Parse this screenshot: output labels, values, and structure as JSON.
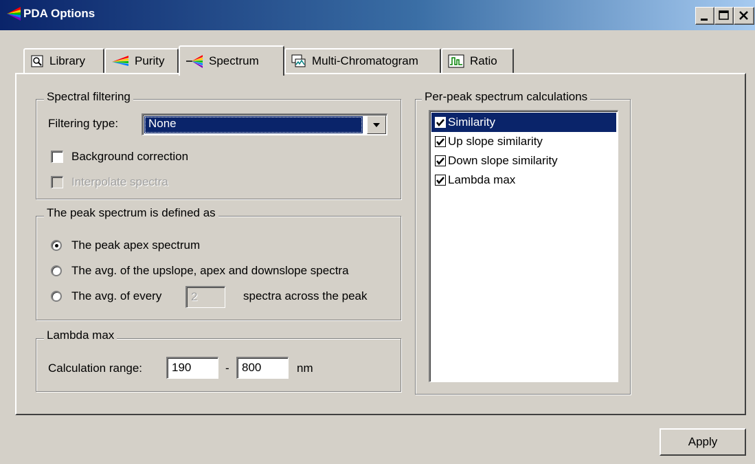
{
  "window": {
    "title": "PDA Options",
    "controls": [
      "minimize",
      "maximize",
      "close"
    ]
  },
  "tabs": [
    {
      "label": "Library",
      "icon": "library-icon",
      "active": false
    },
    {
      "label": "Purity",
      "icon": "purity-icon",
      "active": false
    },
    {
      "label": "Spectrum",
      "icon": "spectrum-icon",
      "active": true
    },
    {
      "label": "Multi-Chromatogram",
      "icon": "multi-chromatogram-icon",
      "active": false
    },
    {
      "label": "Ratio",
      "icon": "ratio-icon",
      "active": false
    }
  ],
  "spectral_filtering": {
    "legend": "Spectral filtering",
    "filter_label": "Filtering type:",
    "filter_value": "None",
    "background_correction": {
      "label": "Background correction",
      "checked": false,
      "enabled": true
    },
    "interpolate_spectra": {
      "label": "Interpolate spectra",
      "checked": false,
      "enabled": false
    }
  },
  "peak_spectrum": {
    "legend": "The peak spectrum is defined as",
    "options": [
      {
        "label": "The peak apex spectrum",
        "selected": true
      },
      {
        "label": "The avg. of the upslope, apex and downslope spectra",
        "selected": false
      }
    ],
    "option3_prefix": "The avg. of every",
    "option3_value": "2",
    "option3_suffix": "spectra across the peak",
    "option3_selected": false
  },
  "lambda_max": {
    "legend": "Lambda max",
    "range_label": "Calculation range:",
    "range_min": "190",
    "separator": "-",
    "range_max": "800",
    "unit": "nm"
  },
  "per_peak": {
    "legend": "Per-peak spectrum calculations",
    "items": [
      {
        "label": "Similarity",
        "checked": true,
        "selected": true
      },
      {
        "label": "Up slope similarity",
        "checked": true,
        "selected": false
      },
      {
        "label": "Down slope similarity",
        "checked": true,
        "selected": false
      },
      {
        "label": "Lambda max",
        "checked": true,
        "selected": false
      }
    ]
  },
  "apply_label": "Apply",
  "colors": {
    "titlebar_start": "#0a246a",
    "titlebar_end": "#a6caf0",
    "face": "#d4d0c8",
    "selection": "#0a246a"
  }
}
